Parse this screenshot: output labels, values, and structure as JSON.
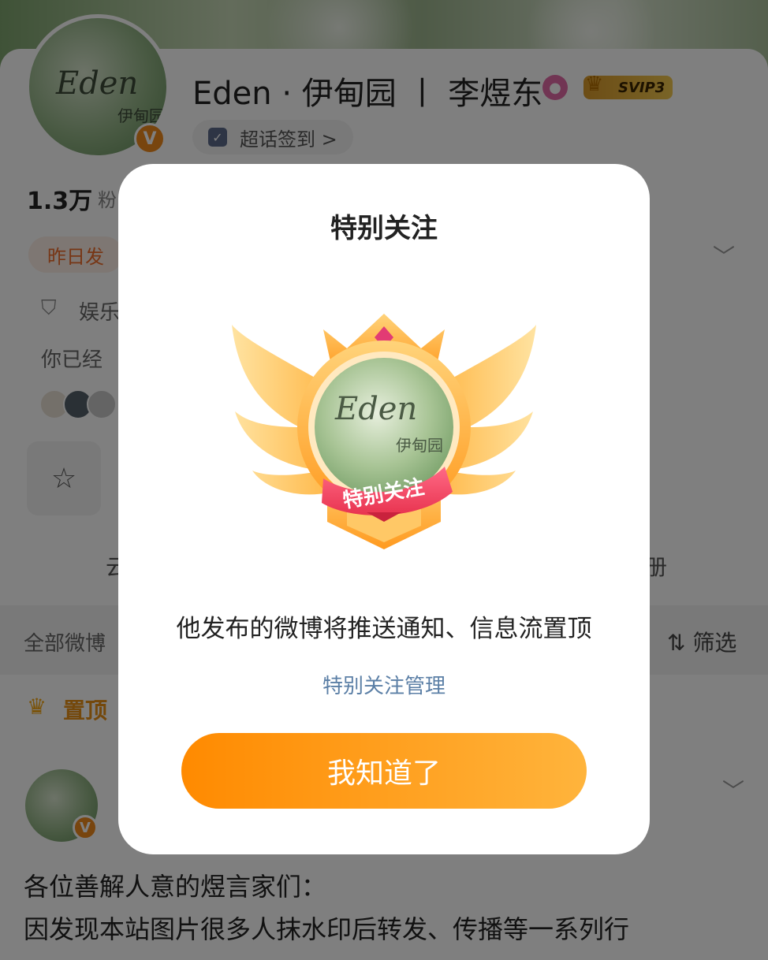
{
  "profile": {
    "avatar_text": "Eden",
    "avatar_subtext": "伊甸园",
    "verified_badge": "V",
    "name": "Eden · 伊甸园 丨 李煜东",
    "vip_label": "SVIP3",
    "supertopic_label": "超话签到 >",
    "fans_count": "1.3万",
    "fans_label": "粉",
    "tag_label": "昨日发",
    "category_label": "娱乐",
    "following_hint": "你已经",
    "tab_left_fragment": "云",
    "tab_right_fragment": "册"
  },
  "feed": {
    "all_weibo_label": "全部微博",
    "filter_label": "筛选",
    "pinned_label": "置顶",
    "post_text_line1": "各位善解人意的煜言家们：",
    "post_text_line2": "因发现本站图片很多人抹水印后转发、传播等一系列行"
  },
  "dialog": {
    "title": "特别关注",
    "badge_avatar_text": "Eden",
    "badge_avatar_subtext": "伊甸园",
    "ribbon_label": "特别关注",
    "description": "他发布的微博将推送通知、信息流置顶",
    "manage_link": "特别关注管理",
    "confirm_button": "我知道了"
  },
  "icons": {
    "verified": "verified-v-icon",
    "pink_search": "pink-badge-icon",
    "vip_crown": "crown-icon",
    "calendar": "calendar-check-icon",
    "chevron": "chevron-down-icon",
    "shield": "shield-icon",
    "card": "star-card-icon",
    "filter": "filter-sort-icon",
    "pin": "crown-pin-icon"
  },
  "colors": {
    "accent_orange": "#ff8a00",
    "link_blue": "#5b7fa6",
    "tag_orange": "#ef6c2a",
    "pin_gold": "#e89017"
  }
}
